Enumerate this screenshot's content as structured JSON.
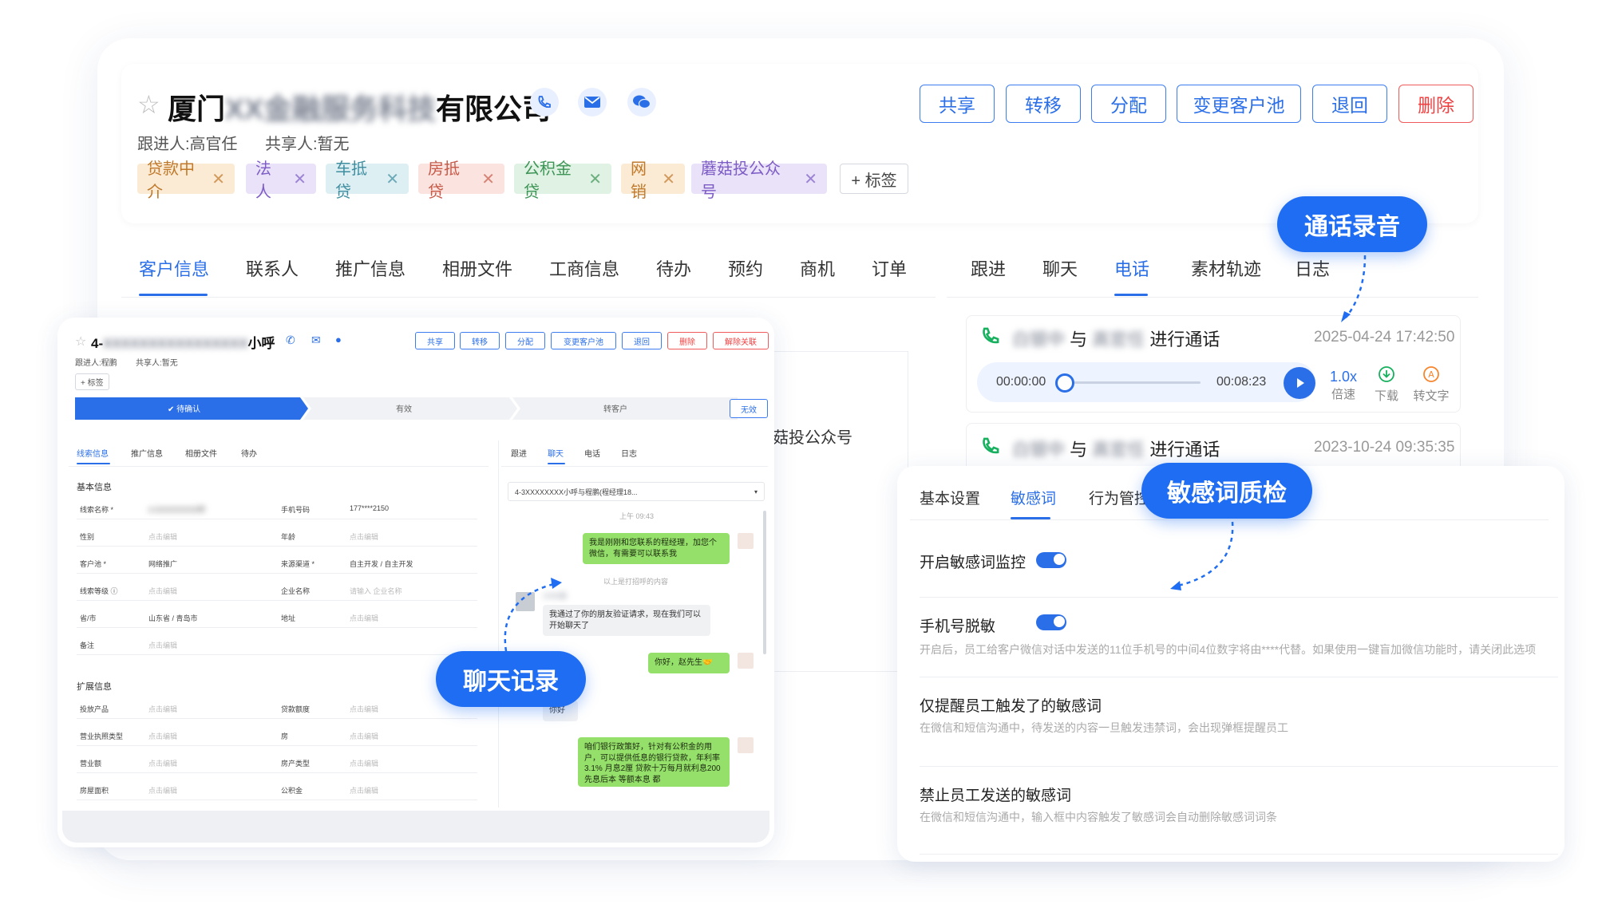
{
  "company": {
    "name_prefix": "厦门",
    "name_blurred": "XX金融服务科技",
    "name_suffix": "有限公司",
    "follower": "跟进人:高官任",
    "sharer": "共享人:暂无"
  },
  "actions": [
    "共享",
    "转移",
    "分配",
    "变更客户池",
    "退回",
    "删除"
  ],
  "tags": [
    {
      "label": "贷款中介",
      "bg": "#fbead4",
      "fg": "#c0792a"
    },
    {
      "label": "法人",
      "bg": "#e9e2f8",
      "fg": "#7d5cc6"
    },
    {
      "label": "车抵贷",
      "bg": "#ddeff3",
      "fg": "#3f8ea0"
    },
    {
      "label": "房抵贷",
      "bg": "#fbe3df",
      "fg": "#c75b4a"
    },
    {
      "label": "公积金贷",
      "bg": "#e0f2e3",
      "fg": "#3c9455"
    },
    {
      "label": "网销",
      "bg": "#fbead4",
      "fg": "#c0792a"
    },
    {
      "label": "蘑菇投公众号",
      "bg": "#e9e2f8",
      "fg": "#7d5cc6"
    }
  ],
  "add_tag": "+ 标签",
  "left_tabs": [
    "客户信息",
    "联系人",
    "推广信息",
    "相册文件",
    "工商信息",
    "待办",
    "预约",
    "商机",
    "订单"
  ],
  "right_tabs": [
    "跟进",
    "聊天",
    "电话",
    "素材轨迹",
    "日志"
  ],
  "bg_text_fragment": "菇投公众号",
  "calls": [
    {
      "from": "白银中",
      "with": "与",
      "to": "高官任",
      "action": "进行通话",
      "time": "2025-04-24 17:42:50"
    },
    {
      "from": "白银中",
      "with": "与",
      "to": "高官任",
      "action": "进行通话",
      "time": "2023-10-24 09:35:35"
    }
  ],
  "player": {
    "start": "00:00:00",
    "end": "00:08:23",
    "speed": "1.0x",
    "speed_label": "倍速",
    "download": "下载",
    "to_text": "转文字",
    "progress": 0.0
  },
  "callouts": {
    "recording": "通话录音",
    "sensitive": "敏感词质检",
    "chat": "聊天记录"
  },
  "sensitive": {
    "tabs": [
      "基本设置",
      "敏感词",
      "行为管控"
    ],
    "items": [
      {
        "title": "开启敏感词监控",
        "desc": "",
        "toggle": true
      },
      {
        "title": "手机号脱敏",
        "desc": "开启后，员工给客户微信对话中发送的11位手机号的中间4位数字将由****代替。如果使用一键盲加微信功能时，请关闭此选项",
        "toggle": true
      },
      {
        "title": "仅提醒员工触发了的敏感词",
        "desc": "在微信和短信沟通中，待发送的内容一旦触发违禁词，会出现弹框提醒员工",
        "toggle": false
      },
      {
        "title": "禁止员工发送的敏感词",
        "desc": "在微信和短信沟通中，输入框中内容触发了敏感词会自动删除敏感词词条",
        "toggle": false
      }
    ]
  },
  "lead": {
    "title_prefix": "4-",
    "title_suffix": "小呼",
    "follower": "跟进人:程鹏",
    "sharer": "共享人:暂无",
    "add_tag": "+ 标签",
    "actions": [
      "共享",
      "转移",
      "分配",
      "变更客户池",
      "退回",
      "删除",
      "解除关联"
    ],
    "steps": [
      "待确认",
      "有效",
      "转客户"
    ],
    "invalid": "无效",
    "tabs": [
      "线索信息",
      "推广信息",
      "相册文件",
      "待办"
    ],
    "basic_title": "基本信息",
    "basic_rows": [
      [
        "线索名称 *",
        "4-XXXXXXXXX呼",
        "手机号码",
        "177****2150"
      ],
      [
        "性别",
        "点击编辑",
        "年龄",
        "点击编辑"
      ],
      [
        "客户池 *",
        "网络推广",
        "来源渠道 *",
        "自主开发 / 自主开发"
      ],
      [
        "线索等级 ⓘ",
        "点击编辑",
        "企业名称",
        "请输入 企业名称"
      ],
      [
        "省/市",
        "山东省 / 青岛市",
        "地址",
        "点击编辑"
      ],
      [
        "备注",
        "点击编辑",
        "",
        ""
      ]
    ],
    "ext_title": "扩展信息",
    "ext_rows": [
      [
        "投放产品",
        "点击编辑",
        "贷款额度",
        "点击编辑"
      ],
      [
        "营业执照类型",
        "点击编辑",
        "房",
        "点击编辑"
      ],
      [
        "营业额",
        "点击编辑",
        "房产类型",
        "点击编辑"
      ],
      [
        "房屋面积",
        "点击编辑",
        "公积金",
        "点击编辑"
      ]
    ],
    "chat_tabs": [
      "跟进",
      "聊天",
      "电话",
      "日志"
    ],
    "chat_header": "4-3XXXXXXXX小呼与程鹏(程经理18...",
    "chat_time": "上午 09:43",
    "messages": [
      {
        "side": "right",
        "text": "我是刚刚和您联系的程经理，加您个微信，有需要可以联系我"
      },
      {
        "side": "sys",
        "text": "以上是打招呼的内容"
      },
      {
        "side": "left",
        "name": "小XX呆",
        "text": "我通过了你的朋友验证请求，现在我们可以开始聊天了"
      },
      {
        "side": "right",
        "text": "你好，赵先生🤝"
      },
      {
        "side": "left",
        "name": "",
        "text": "你好"
      },
      {
        "side": "right",
        "text": "咱们银行政策好，针对有公积金的用户，可以提供低息的银行贷款，年利率3.1% 月息2厘 贷款十万每月就利息200 先息后本 等额本息 都"
      }
    ]
  },
  "colors": {
    "accent": "#2b6fe8",
    "danger": "#f04242",
    "callout": "#1f6df2",
    "call_green": "#16b05e"
  },
  "icons": [
    "star-icon",
    "phone-icon",
    "mail-icon",
    "wechat-icon",
    "play-icon",
    "download-icon",
    "to-text-icon",
    "close-icon"
  ]
}
